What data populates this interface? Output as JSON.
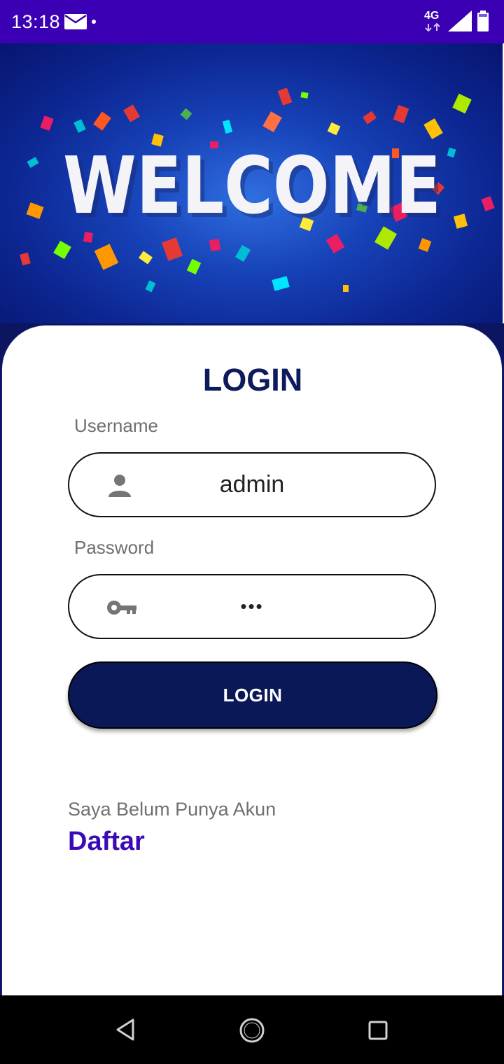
{
  "status_bar": {
    "time": "13:18",
    "network": "4G",
    "icons": [
      "mail-icon",
      "notification-dot-icon",
      "network-arrows-icon",
      "signal-icon",
      "battery-icon"
    ]
  },
  "banner": {
    "text": "WELCOME"
  },
  "login_form": {
    "title": "LOGIN",
    "username": {
      "label": "Username",
      "value": "admin",
      "icon": "person-icon"
    },
    "password": {
      "label": "Password",
      "value": "•••",
      "icon": "key-icon"
    },
    "submit_label": "LOGIN"
  },
  "register": {
    "prompt": "Saya Belum Punya Akun",
    "link_label": "Daftar"
  },
  "nav_bar": {
    "icons": [
      "back-icon",
      "home-icon",
      "recents-icon"
    ]
  },
  "colors": {
    "status_bar": "#3b00b3",
    "primary_dark": "#0b1858",
    "title": "#0d1a5c",
    "link": "#3b0ab8"
  }
}
